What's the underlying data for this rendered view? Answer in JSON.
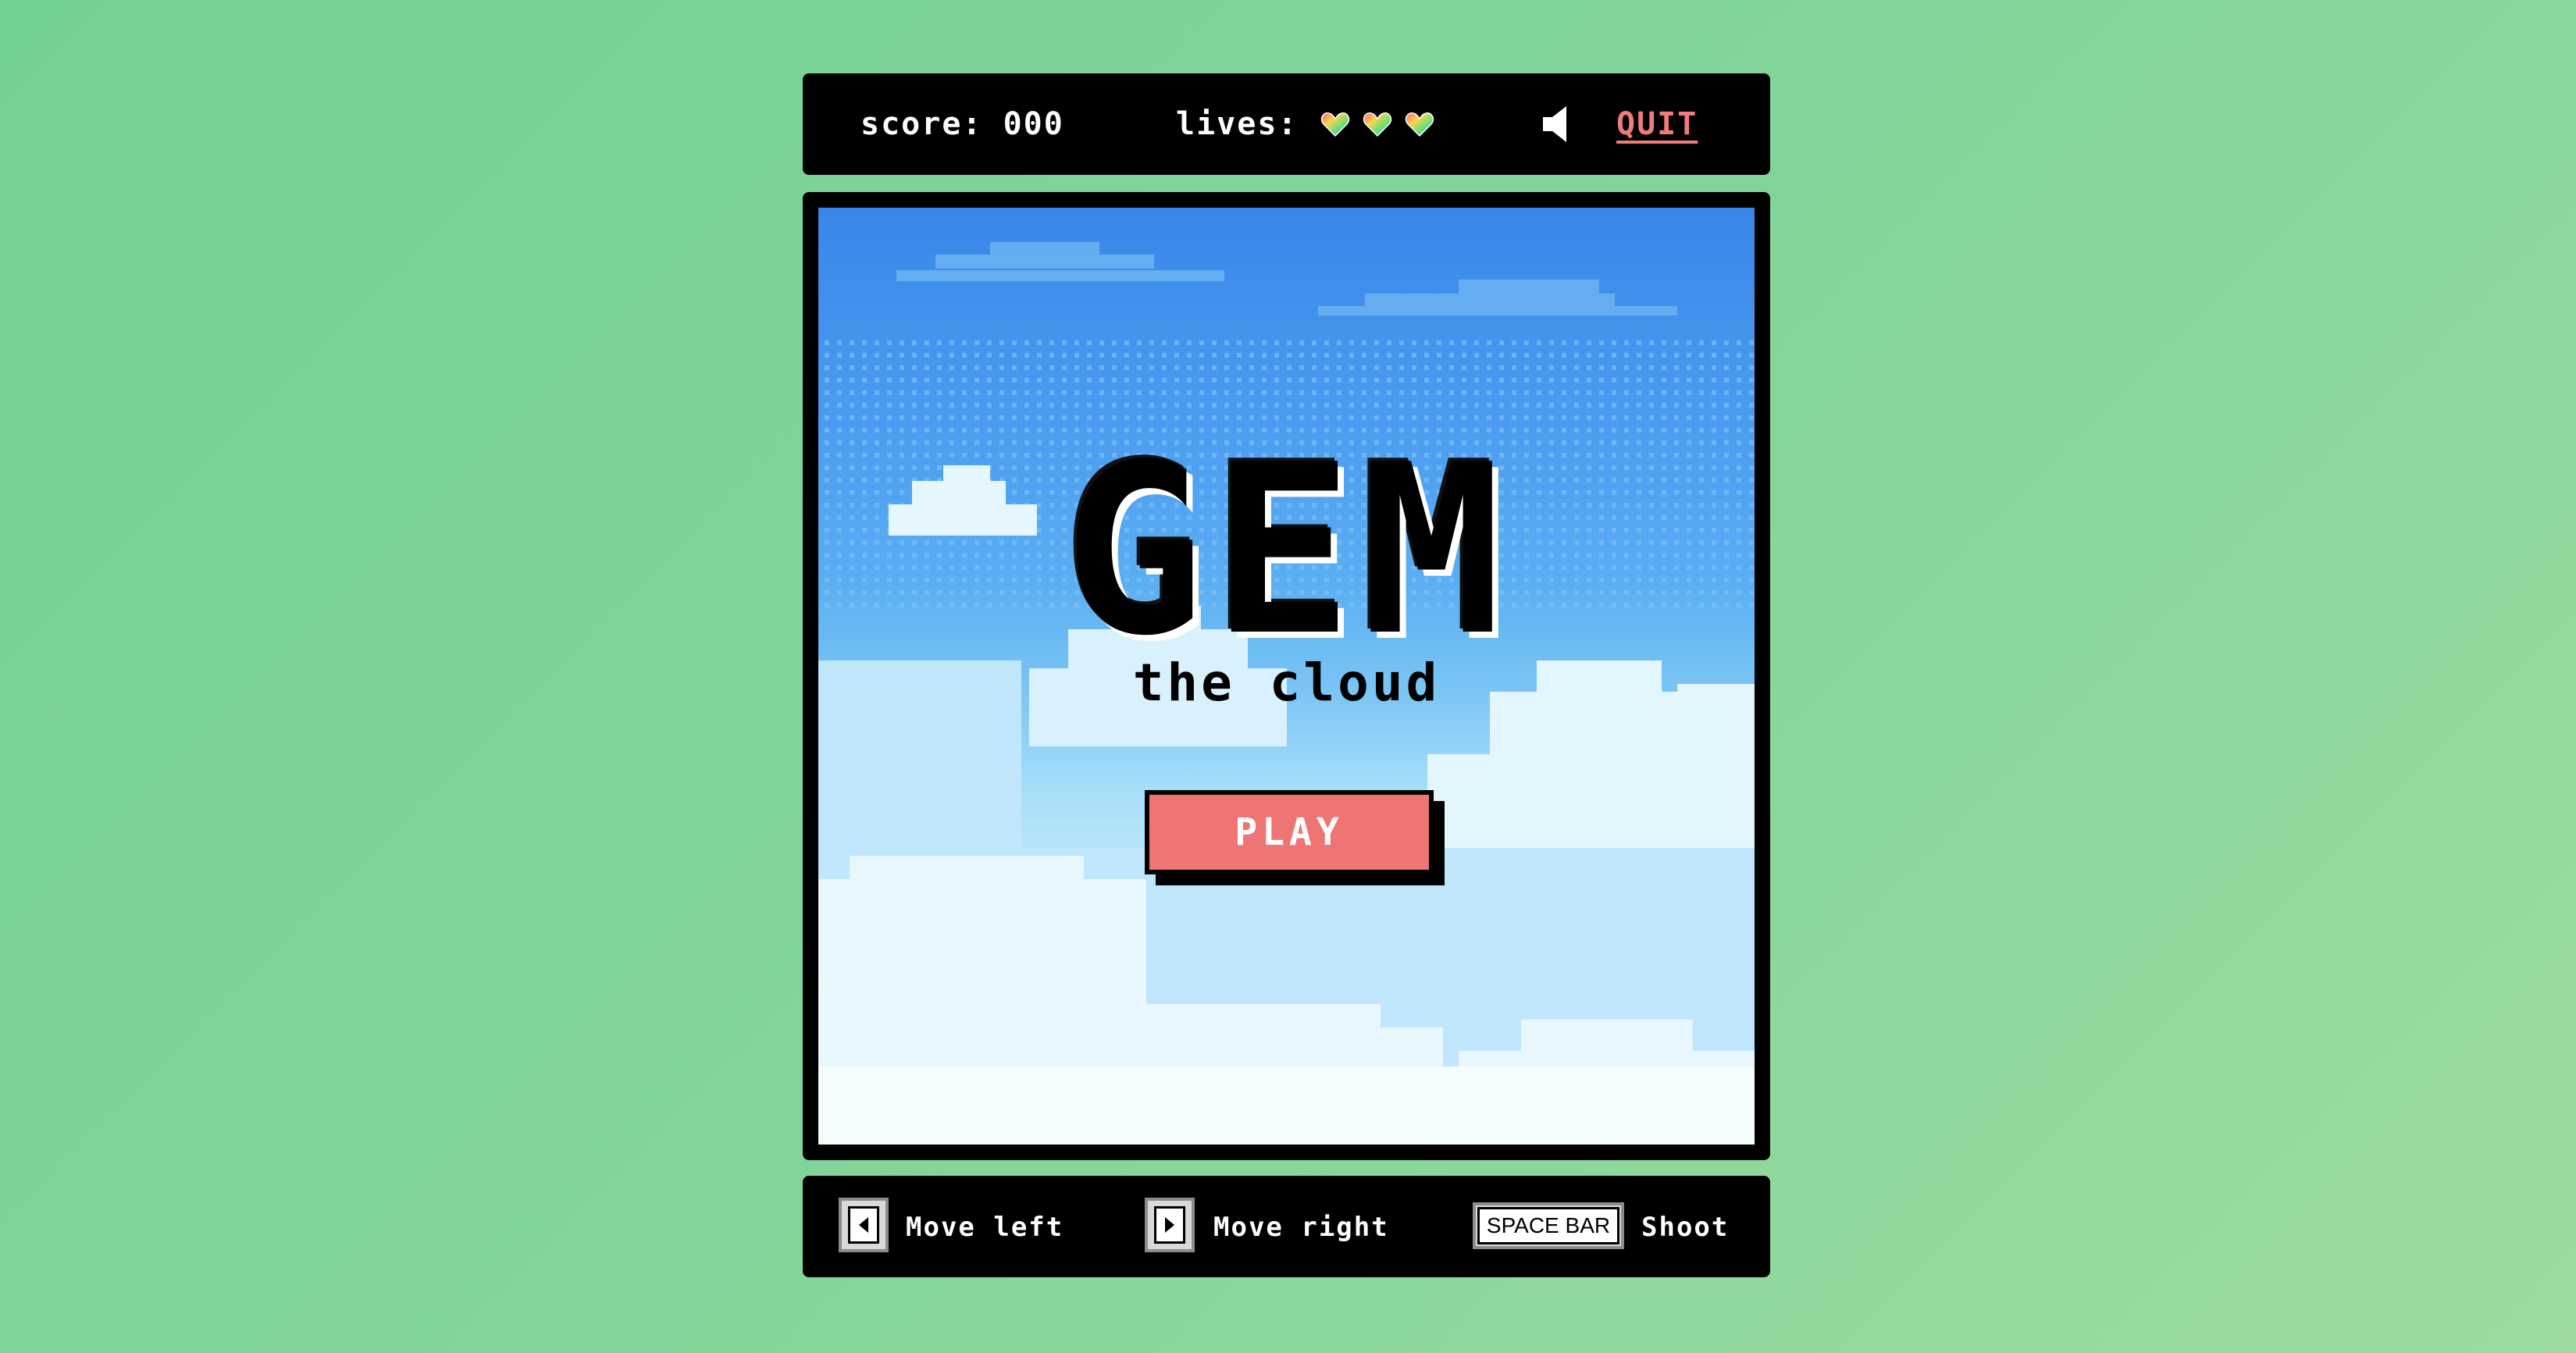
{
  "hud": {
    "score_label": "score:",
    "score_value": "000",
    "lives_label": "lives:",
    "lives_count": 3,
    "heart_icon": "rainbow-heart-icon",
    "sound_icon": "speaker-icon",
    "quit_label": "QUIT",
    "quit_color": "#ef7b7b"
  },
  "game": {
    "title": "GEM",
    "subtitle": "the cloud",
    "play_label": "PLAY",
    "play_color": "#ef7474"
  },
  "controls": {
    "left_key_icon": "arrow-left-key-icon",
    "left_label": "Move left",
    "right_key_icon": "arrow-right-key-icon",
    "right_label": "Move right",
    "space_key": "SPACE BAR",
    "space_label": "Shoot"
  },
  "colors": {
    "background": "#7fd49a",
    "panel": "#000000",
    "sky_top": "#3a86e8",
    "cloud": "#eef9fd"
  }
}
